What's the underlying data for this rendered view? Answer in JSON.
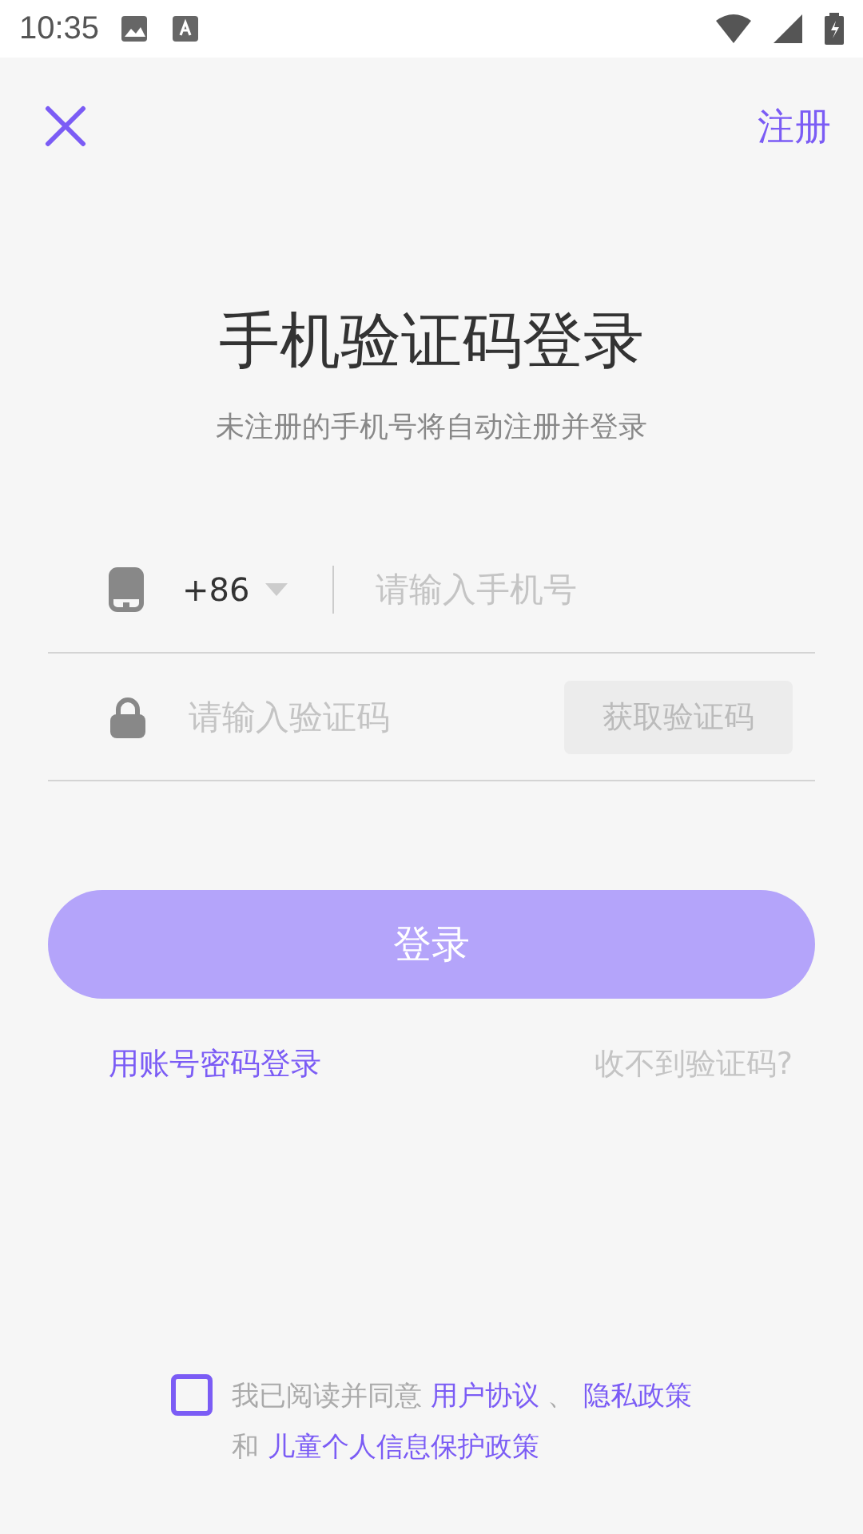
{
  "status_bar": {
    "time": "10:35"
  },
  "top_bar": {
    "register": "注册"
  },
  "title": "手机验证码登录",
  "subtitle": "未注册的手机号将自动注册并登录",
  "phone": {
    "country_code": "+86",
    "placeholder": "请输入手机号"
  },
  "code": {
    "placeholder": "请输入验证码",
    "send_button": {
      "label": "获取验证码",
      "disabled": true
    }
  },
  "login_button": {
    "label": "登录",
    "disabled": true
  },
  "password_login": "用账号密码登录",
  "no_code": "收不到验证码?",
  "agreement": {
    "checked": false,
    "lines": [
      [
        {
          "kind": "text",
          "text": "我已阅读并同意 "
        },
        {
          "kind": "link",
          "text": "用户协议"
        },
        {
          "kind": "text",
          "text": " 、 "
        },
        {
          "kind": "link",
          "text": "隐私政策"
        }
      ],
      [
        {
          "kind": "text",
          "text": "和 "
        },
        {
          "kind": "link",
          "text": "儿童个人信息保护政策"
        }
      ]
    ]
  }
}
